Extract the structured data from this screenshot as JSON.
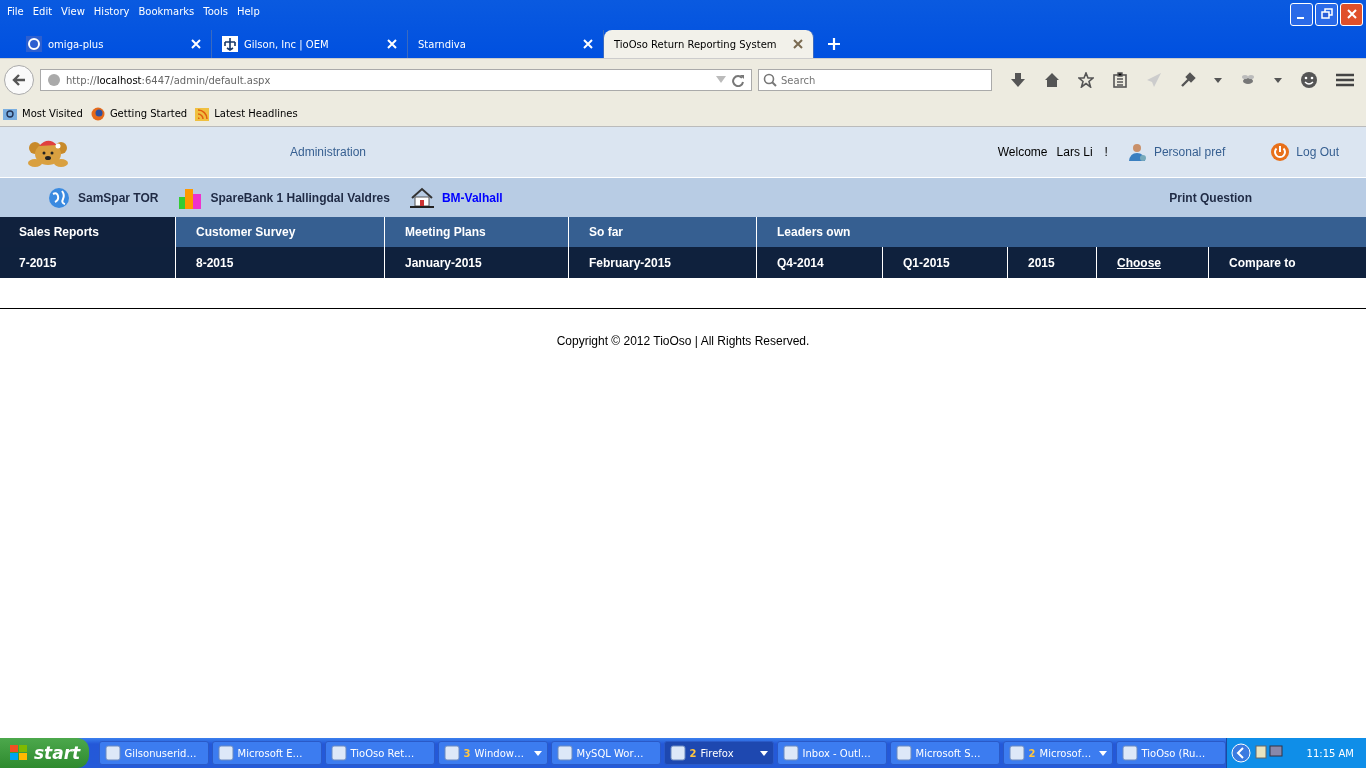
{
  "browser": {
    "menu": [
      "File",
      "Edit",
      "View",
      "History",
      "Bookmarks",
      "Tools",
      "Help"
    ],
    "tabs": [
      {
        "title": "omiga-plus",
        "selected": false
      },
      {
        "title": "Gilson, Inc | OEM",
        "selected": false
      },
      {
        "title": "Starndiva",
        "selected": false
      },
      {
        "title": "TioOso Return Reporting System",
        "selected": true
      }
    ],
    "address": {
      "scheme": "http://",
      "host": "localhost",
      "path": ":6447/admin/default.aspx"
    },
    "search": {
      "placeholder": "Search"
    },
    "bookmarks": [
      "Most Visited",
      "Getting Started",
      "Latest Headlines"
    ]
  },
  "header": {
    "admin_link": "Administration",
    "welcome": "Welcome",
    "user": "Lars Li",
    "exclaim": "!",
    "personal_pref": "Personal pref",
    "logout": "Log Out"
  },
  "companies": [
    {
      "name": "SamSpar TOR",
      "selected": false
    },
    {
      "name": "SpareBank 1 Hallingdal Valdres",
      "selected": false
    },
    {
      "name": "BM-Valhall",
      "selected": true
    }
  ],
  "print_question": "Print Question",
  "nav": [
    {
      "label": "Sales Reports",
      "selected": true
    },
    {
      "label": "Customer Survey",
      "selected": false
    },
    {
      "label": "Meeting Plans",
      "selected": false
    },
    {
      "label": "So far",
      "selected": false
    },
    {
      "label": "Leaders own",
      "selected": false
    }
  ],
  "periods": [
    {
      "label": "7-2015",
      "kind": "text"
    },
    {
      "label": "8-2015",
      "kind": "text"
    },
    {
      "label": "January-2015",
      "kind": "text"
    },
    {
      "label": "February-2015",
      "kind": "text"
    },
    {
      "label": "Q4-2014",
      "kind": "text"
    },
    {
      "label": "Q1-2015",
      "kind": "text"
    },
    {
      "label": "2015",
      "kind": "text"
    },
    {
      "label": "Choose",
      "kind": "link"
    },
    {
      "label": "Compare to",
      "kind": "text"
    }
  ],
  "footer": "Copyright © 2012 TioOso | All Rights Reserved.",
  "taskbar": {
    "start": "start",
    "items": [
      {
        "label": "Gilsonuserid…",
        "selected": false
      },
      {
        "label": "Microsoft E…",
        "selected": false
      },
      {
        "label": "TioOso Ret…",
        "selected": false
      },
      {
        "count": "3",
        "label": "Window…",
        "dropdown": true,
        "selected": false
      },
      {
        "label": "MySQL Wor…",
        "selected": false
      },
      {
        "count": "2",
        "label": "Firefox",
        "dropdown": true,
        "selected": true
      },
      {
        "label": "Inbox - Outl…",
        "selected": false
      },
      {
        "label": "Microsoft S…",
        "selected": false
      },
      {
        "count": "2",
        "label": "Microsof…",
        "dropdown": true,
        "selected": false
      },
      {
        "label": "TioOso (Ru…",
        "selected": false
      }
    ],
    "clock": "11:15 AM"
  }
}
